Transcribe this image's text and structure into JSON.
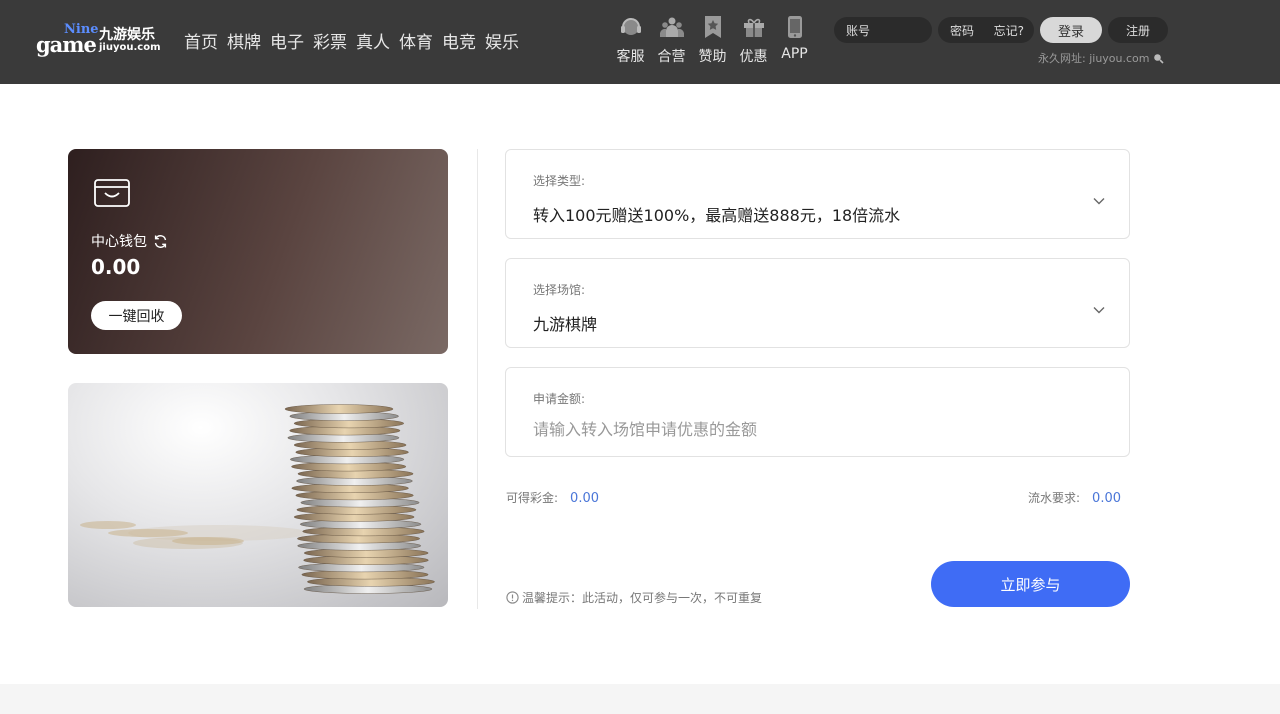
{
  "header": {
    "logo": {
      "game": "game",
      "nine": "Nine",
      "name_cn": "九游娱乐",
      "domain": "jiuyou.com"
    },
    "nav": [
      "首页",
      "棋牌",
      "电子",
      "彩票",
      "真人",
      "体育",
      "电竞",
      "娱乐"
    ],
    "quick_links": [
      {
        "label": "客服",
        "icon": "headset-icon"
      },
      {
        "label": "合营",
        "icon": "people-icon"
      },
      {
        "label": "赞助",
        "icon": "bookmark-star-icon"
      },
      {
        "label": "优惠",
        "icon": "gift-icon"
      },
      {
        "label": "APP",
        "icon": "phone-icon"
      }
    ],
    "login": {
      "account_placeholder": "账号",
      "password_placeholder": "密码",
      "forgot_label": "忘记?",
      "login_label": "登录",
      "register_label": "注册"
    },
    "permanent_url": "永久网址: jiuyou.com"
  },
  "wallet": {
    "label": "中心钱包",
    "amount": "0.00",
    "recall_label": "一键回收"
  },
  "form": {
    "type_label": "选择类型:",
    "type_value": "转入100元赠送100%，最高赠送888元，18倍流水",
    "venue_label": "选择场馆:",
    "venue_value": "九游棋牌",
    "amount_label": "申请金额:",
    "amount_placeholder": "请输入转入场馆申请优惠的金额",
    "bonus_label": "可得彩金:",
    "bonus_value": "0.00",
    "turnover_label": "流水要求:",
    "turnover_value": "0.00",
    "tip": "温馨提示：此活动，仅可参与一次，不可重复",
    "submit_label": "立即参与"
  },
  "colors": {
    "header_bg": "#3a3a3a",
    "accent": "#3f6cf5",
    "value_blue": "#4a76d8"
  }
}
